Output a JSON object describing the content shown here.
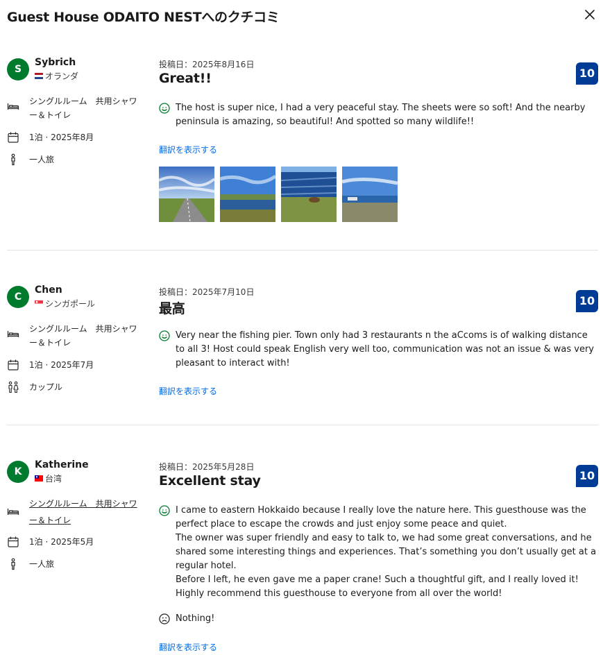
{
  "header": {
    "title": "Guest House ODAITO NESTへのクチコミ"
  },
  "colors": {
    "avatar_bg": "#007b2e",
    "score_bg": "#003b95",
    "link": "#006ce4",
    "positive_face": "#007b2e"
  },
  "reviews": [
    {
      "initial": "S",
      "name": "Sybrich",
      "country": "オランダ",
      "room": "シングルルーム　共用シャワー＆トイレ",
      "stay": "1泊 · 2025年8月",
      "traveler_type": "一人旅",
      "date": "投稿日：2025年8月16日",
      "title": "Great!!",
      "score": "10",
      "positive": "The host is super nice, I had a very peaceful stay. The sheets were so soft! And the nearby peninsula is amazing, so beautiful! And spotted so many wildlife!!",
      "translate": "翻訳を表示する"
    },
    {
      "initial": "C",
      "name": "Chen",
      "country": "シンガポール",
      "room": "シングルルーム　共用シャワー＆トイレ",
      "stay": "1泊 · 2025年7月",
      "traveler_type": "カップル",
      "date": "投稿日：2025年7月10日",
      "title": "最高",
      "score": "10",
      "positive": "Very near the fishing pier. Town only had 3 restaurants n the aCcoms is of walking distance to all 3! Host could speak English very well too, communication was not an issue & was very pleasant to interact with!",
      "translate": "翻訳を表示する"
    },
    {
      "initial": "K",
      "name": "Katherine",
      "country": "台湾",
      "room": "シングルルーム　共用シャワー＆トイレ",
      "stay": "1泊 · 2025年5月",
      "traveler_type": "一人旅",
      "date": "投稿日：2025年5月28日",
      "title": "Excellent stay",
      "score": "10",
      "positive": "I came to eastern Hokkaido because I really love the nature here. This guesthouse was the perfect place to escape the crowds and just enjoy some peace and quiet.\nThe owner was super friendly and easy to talk to, we had some great conversations, and he shared some interesting things and experiences. That’s something you don’t usually get at a regular hotel.\nBefore I left, he even gave me a paper crane! Such a thoughtful gift, and I really loved it!\nHighly recommend this guesthouse to everyone from all over the world!",
      "negative": "Nothing!",
      "translate": "翻訳を表示する"
    }
  ]
}
